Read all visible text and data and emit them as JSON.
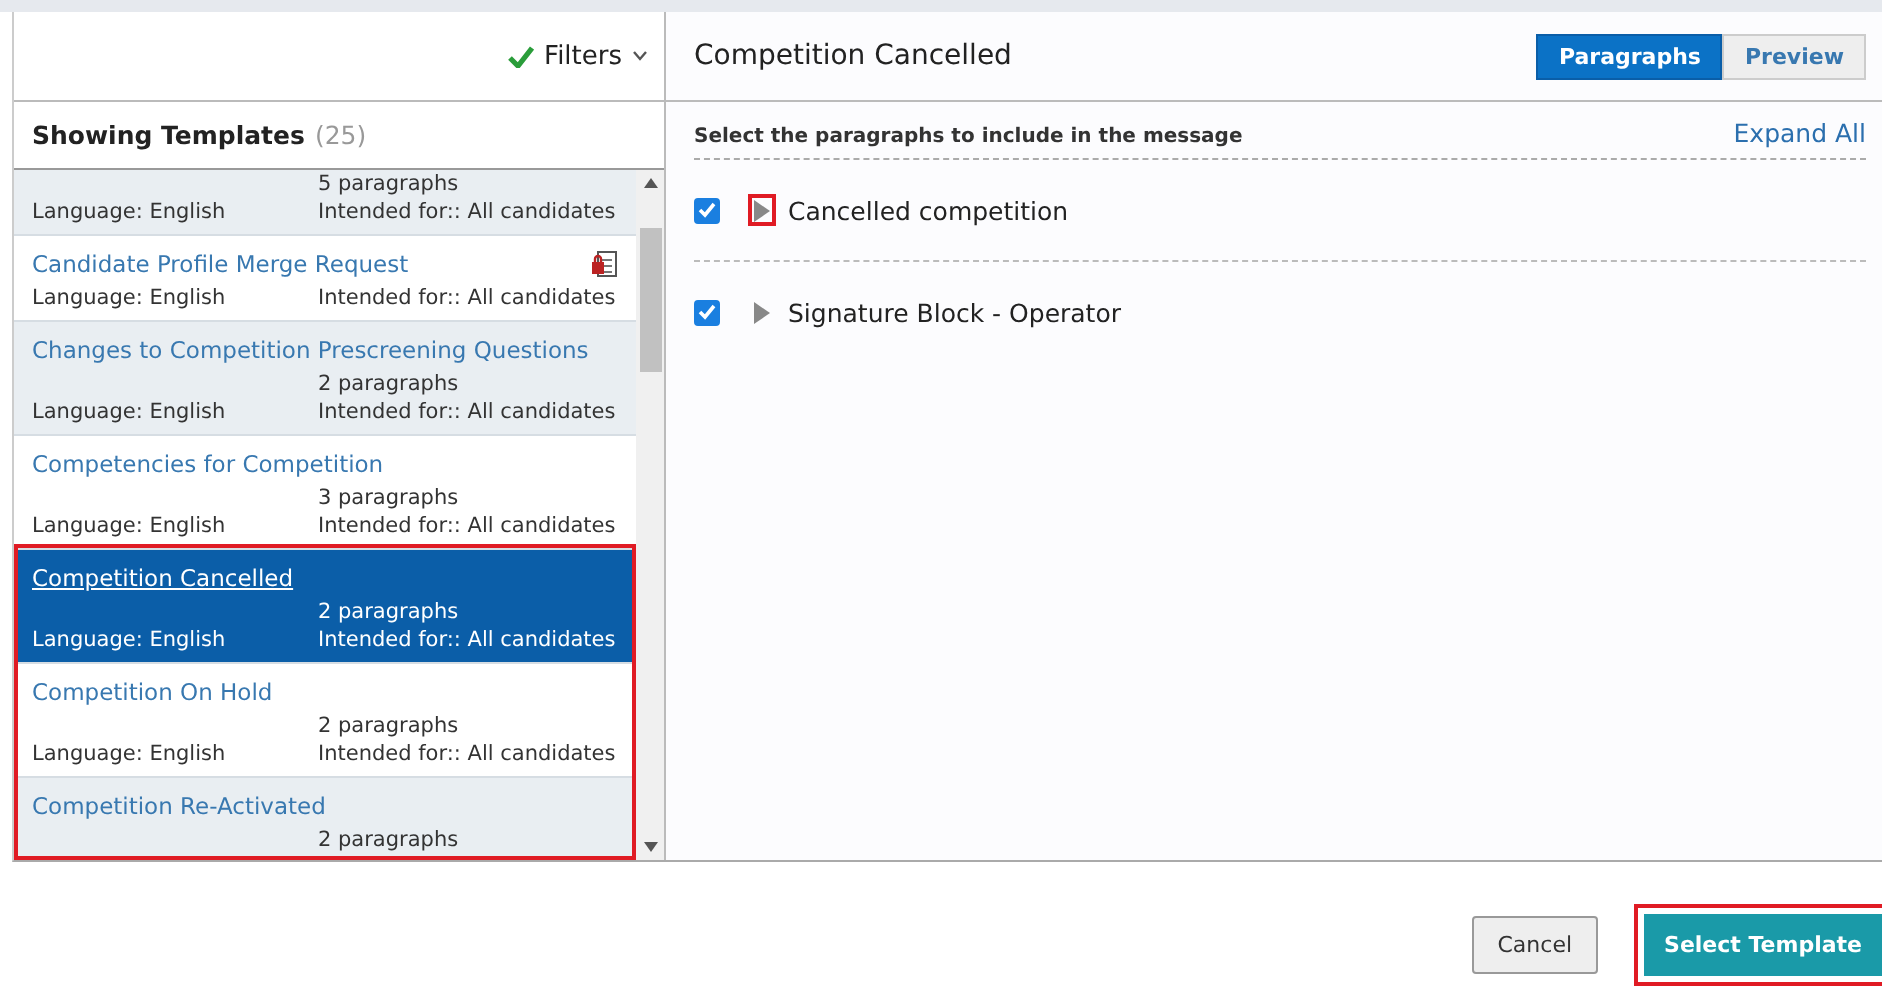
{
  "filters": {
    "label": "Filters",
    "active": true
  },
  "list_header": {
    "title": "Showing Templates",
    "count": "(25)"
  },
  "templates": [
    {
      "paragraphs": "5 paragraphs",
      "language": "Language: English",
      "intended": "Intended for:: All candidates",
      "selected": false
    },
    {
      "title": "Candidate Profile Merge Request",
      "language": "Language: English",
      "intended": "Intended for:: All candidates",
      "selected": false,
      "locked": true
    },
    {
      "title": "Changes to Competition Prescreening Questions",
      "paragraphs": "2 paragraphs",
      "language": "Language: English",
      "intended": "Intended for:: All candidates",
      "selected": false,
      "locked": false
    },
    {
      "title": "Competencies for Competition",
      "paragraphs": "3 paragraphs",
      "language": "Language: English",
      "intended": "Intended for:: All candidates",
      "selected": false,
      "locked": false
    },
    {
      "title": "Competition Cancelled",
      "paragraphs": "2 paragraphs",
      "language": "Language: English",
      "intended": "Intended for:: All candidates",
      "selected": true,
      "locked": false
    },
    {
      "title": "Competition On Hold",
      "paragraphs": "2 paragraphs",
      "language": "Language: English",
      "intended": "Intended for:: All candidates",
      "selected": false,
      "locked": false
    },
    {
      "title": "Competition Re-Activated",
      "paragraphs": "2 paragraphs",
      "selected": false,
      "locked": false
    }
  ],
  "detail": {
    "title": "Competition Cancelled",
    "view_tabs": [
      {
        "label": "Paragraphs",
        "selected": true
      },
      {
        "label": "Preview",
        "selected": false
      }
    ],
    "instruction": "Select the paragraphs to include in the message",
    "expand_all": "Expand All",
    "paragraphs": [
      {
        "title": "Cancelled competition",
        "checked": true,
        "expanded": false,
        "highlighted": true
      },
      {
        "title": "Signature Block - Operator",
        "checked": true,
        "expanded": false,
        "highlighted": false
      }
    ]
  },
  "buttons": {
    "cancel": "Cancel",
    "select": "Select Template"
  },
  "highlights": {
    "list": true,
    "select_button": true
  }
}
